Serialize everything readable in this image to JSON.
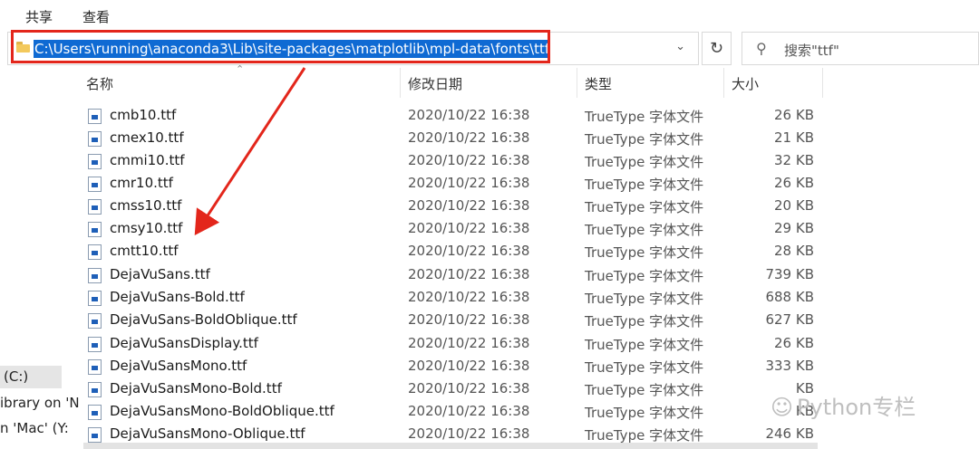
{
  "ribbon": {
    "tab_share": "共享",
    "tab_view": "查看"
  },
  "address_bar": {
    "path": "C:\\Users\\running\\anaconda3\\Lib\\site-packages\\matplotlib\\mpl-data\\fonts\\ttf"
  },
  "search": {
    "placeholder": "搜索\"ttf\""
  },
  "columns": {
    "name": "名称",
    "date": "修改日期",
    "type": "类型",
    "size": "大小"
  },
  "sidebar": {
    "items": [
      {
        "label": "(C:)"
      },
      {
        "label": "ibrary on 'N"
      },
      {
        "label": "n 'Mac' (Y:"
      }
    ]
  },
  "files": [
    {
      "name": "cmb10.ttf",
      "date": "2020/10/22 16:38",
      "type": "TrueType 字体文件",
      "size": "26 KB"
    },
    {
      "name": "cmex10.ttf",
      "date": "2020/10/22 16:38",
      "type": "TrueType 字体文件",
      "size": "21 KB"
    },
    {
      "name": "cmmi10.ttf",
      "date": "2020/10/22 16:38",
      "type": "TrueType 字体文件",
      "size": "32 KB"
    },
    {
      "name": "cmr10.ttf",
      "date": "2020/10/22 16:38",
      "type": "TrueType 字体文件",
      "size": "26 KB"
    },
    {
      "name": "cmss10.ttf",
      "date": "2020/10/22 16:38",
      "type": "TrueType 字体文件",
      "size": "20 KB"
    },
    {
      "name": "cmsy10.ttf",
      "date": "2020/10/22 16:38",
      "type": "TrueType 字体文件",
      "size": "29 KB"
    },
    {
      "name": "cmtt10.ttf",
      "date": "2020/10/22 16:38",
      "type": "TrueType 字体文件",
      "size": "28 KB"
    },
    {
      "name": "DejaVuSans.ttf",
      "date": "2020/10/22 16:38",
      "type": "TrueType 字体文件",
      "size": "739 KB"
    },
    {
      "name": "DejaVuSans-Bold.ttf",
      "date": "2020/10/22 16:38",
      "type": "TrueType 字体文件",
      "size": "688 KB"
    },
    {
      "name": "DejaVuSans-BoldOblique.ttf",
      "date": "2020/10/22 16:38",
      "type": "TrueType 字体文件",
      "size": "627 KB"
    },
    {
      "name": "DejaVuSansDisplay.ttf",
      "date": "2020/10/22 16:38",
      "type": "TrueType 字体文件",
      "size": "26 KB"
    },
    {
      "name": "DejaVuSansMono.ttf",
      "date": "2020/10/22 16:38",
      "type": "TrueType 字体文件",
      "size": "333 KB"
    },
    {
      "name": "DejaVuSansMono-Bold.ttf",
      "date": "2020/10/22 16:38",
      "type": "TrueType 字体文件",
      "size": "KB"
    },
    {
      "name": "DejaVuSansMono-BoldOblique.ttf",
      "date": "2020/10/22 16:38",
      "type": "TrueType 字体文件",
      "size": "KB"
    },
    {
      "name": "DejaVuSansMono-Oblique.ttf",
      "date": "2020/10/22 16:38",
      "type": "TrueType 字体文件",
      "size": "246 KB"
    }
  ],
  "watermark": {
    "text": "Python专栏"
  },
  "colors": {
    "highlight_border": "#e3261b",
    "selection": "#0f6ad3",
    "annotation_arrow": "#e3261b"
  }
}
